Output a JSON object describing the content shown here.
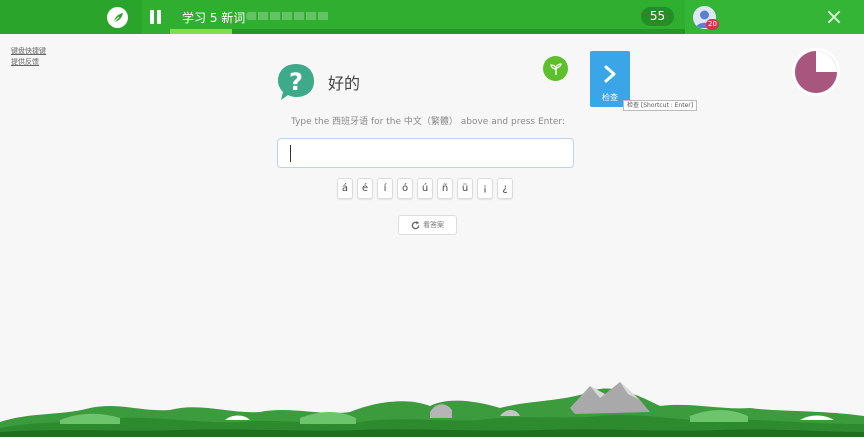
{
  "topbar": {
    "session_title": "学习 5 新词",
    "progress_pct": 12,
    "count": "55",
    "avatar_badge": "20",
    "colors": {
      "bar": "#2fae2f",
      "progress": "#7be04b"
    }
  },
  "side_links": [
    "键盘快捷键",
    "提供反馈"
  ],
  "question": {
    "prompt_word": "好的",
    "instruction": "Type the 西班牙语 for the 中文（繁體） above and press Enter:",
    "input_value": "",
    "input_placeholder": ""
  },
  "check_button": {
    "label": "检查",
    "tooltip": "检查 [Shortcut : Enter]",
    "color": "#3aa6e8"
  },
  "accents": [
    "á",
    "é",
    "í",
    "ó",
    "ú",
    "ñ",
    "ü",
    "¡",
    "¿"
  ],
  "show_answer": {
    "label": "看答案"
  },
  "timer": {
    "fraction_remaining": 0.75,
    "color": "#a8567e"
  },
  "icons": {
    "logo": "memrise-logo-icon",
    "pause": "pause-icon",
    "close": "close-icon",
    "question": "question-bubble-icon",
    "sprout": "sprout-icon",
    "check": "chevron-right-icon",
    "refresh": "refresh-icon"
  }
}
